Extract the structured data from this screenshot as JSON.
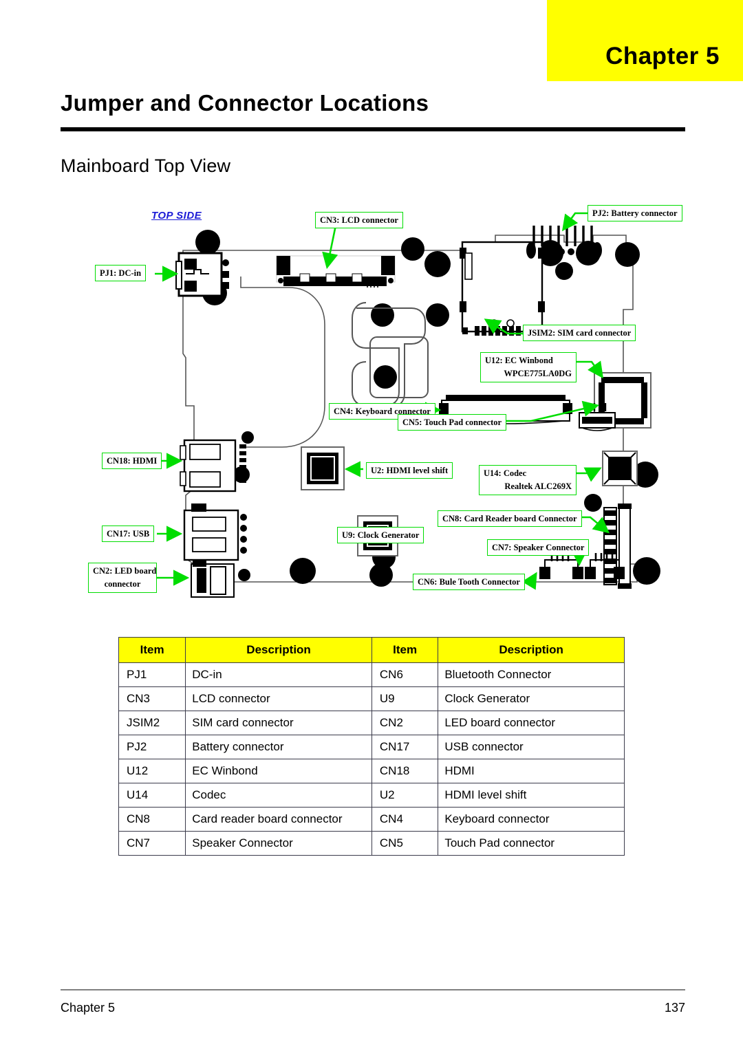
{
  "chapter_banner": {
    "label": "Chapter  5"
  },
  "page_title": "Jumper and Connector Locations",
  "section_title": "Mainboard Top View",
  "diagram": {
    "top_side_label": "TOP SIDE",
    "callouts": [
      {
        "id": "pj1",
        "text": "PJ1: DC-in"
      },
      {
        "id": "cn3",
        "text": "CN3: LCD connector"
      },
      {
        "id": "pj2",
        "text": "PJ2: Battery connector"
      },
      {
        "id": "jsim2",
        "text": "JSIM2: SIM card connector"
      },
      {
        "id": "u12",
        "line1": "U12: EC Winbond",
        "line2": "WPCE775LA0DG"
      },
      {
        "id": "cn4",
        "text": "CN4: Keyboard connector"
      },
      {
        "id": "cn5",
        "text": "CN5: Touch Pad connector"
      },
      {
        "id": "cn18",
        "text": "CN18: HDMI"
      },
      {
        "id": "u2",
        "text": "U2: HDMI level shift"
      },
      {
        "id": "u14",
        "line1": "U14: Codec",
        "line2": "Realtek ALC269X"
      },
      {
        "id": "cn8",
        "text": "CN8: Card Reader board Connector"
      },
      {
        "id": "cn17",
        "text": "CN17: USB"
      },
      {
        "id": "cn7",
        "text": "CN7: Speaker Connector"
      },
      {
        "id": "u9",
        "text": "U9: Clock Generator"
      },
      {
        "id": "cn2",
        "line1": "CN2: LED board",
        "line2": "connector"
      },
      {
        "id": "cn6",
        "text": "CN6: Bule Tooth Connector"
      }
    ],
    "colors": {
      "callout_border": "#00dd00",
      "arrow": "#00dd00",
      "top_side_text": "#1a1ad6",
      "board_outline": "#000000"
    }
  },
  "table": {
    "headers": [
      "Item",
      "Description",
      "Item",
      "Description"
    ],
    "rows": [
      [
        "PJ1",
        "DC-in",
        "CN6",
        "Bluetooth Connector"
      ],
      [
        "CN3",
        "LCD connector",
        "U9",
        "Clock Generator"
      ],
      [
        "JSIM2",
        "SIM card connector",
        "CN2",
        "LED board connector"
      ],
      [
        "PJ2",
        "Battery connector",
        "CN17",
        "USB connector"
      ],
      [
        "U12",
        "EC Winbond",
        "CN18",
        "HDMI"
      ],
      [
        "U14",
        "Codec",
        "U2",
        "HDMI level shift"
      ],
      [
        "CN8",
        "Card reader board connector",
        "CN4",
        "Keyboard connector"
      ],
      [
        "CN7",
        "Speaker Connector",
        "CN5",
        "Touch Pad connector"
      ]
    ],
    "header_bg": "#ffff00"
  },
  "footer": {
    "left": "Chapter 5",
    "right": "137"
  }
}
